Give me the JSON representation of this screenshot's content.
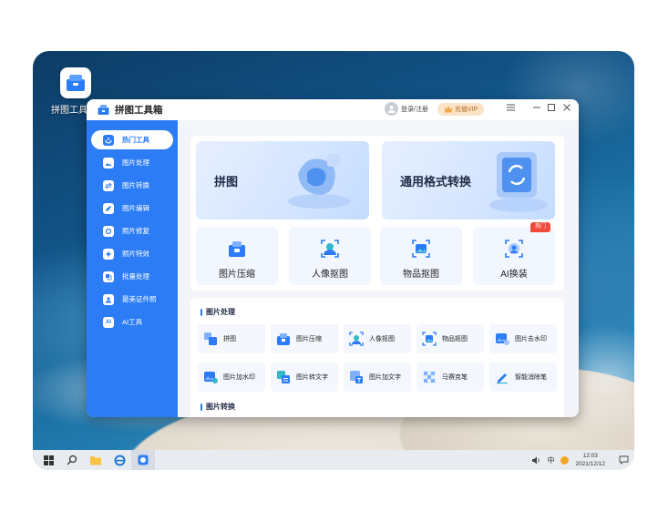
{
  "desktop": {
    "shortcut_label": "拼图工具箱"
  },
  "window": {
    "title": "拼图工具箱",
    "login_label": "登录/注册",
    "vip_label": "充值VIP",
    "controls": [
      "menu",
      "minimize",
      "maximize",
      "close"
    ]
  },
  "sidebar": {
    "items": [
      {
        "label": "热门工具",
        "icon": "hot-tools-icon",
        "active": true
      },
      {
        "label": "图片处理",
        "icon": "image-process-icon"
      },
      {
        "label": "图片转换",
        "icon": "image-convert-icon"
      },
      {
        "label": "图片编辑",
        "icon": "image-edit-icon"
      },
      {
        "label": "照片修复",
        "icon": "photo-repair-icon"
      },
      {
        "label": "照片特效",
        "icon": "photo-effect-icon"
      },
      {
        "label": "批量处理",
        "icon": "batch-icon"
      },
      {
        "label": "最美证件照",
        "icon": "id-photo-icon"
      },
      {
        "label": "AI工具",
        "icon": "ai-tools-icon"
      }
    ]
  },
  "hot": {
    "banners": [
      {
        "label": "拼图"
      },
      {
        "label": "通用格式转换"
      }
    ],
    "cards": [
      {
        "label": "图片压缩",
        "icon": "compress-icon"
      },
      {
        "label": "人像抠图",
        "icon": "portrait-cutout-icon"
      },
      {
        "label": "物品抠图",
        "icon": "object-cutout-icon"
      },
      {
        "label": "AI换装",
        "icon": "ai-outfit-icon",
        "badge": "热门"
      }
    ]
  },
  "image_processing": {
    "title": "图片处理",
    "tools": [
      {
        "label": "拼图",
        "icon": "collage-icon"
      },
      {
        "label": "图片压缩",
        "icon": "compress-icon"
      },
      {
        "label": "人像抠图",
        "icon": "portrait-cutout-icon"
      },
      {
        "label": "物品抠图",
        "icon": "object-cutout-icon"
      },
      {
        "label": "图片去水印",
        "icon": "remove-watermark-icon"
      },
      {
        "label": "图片加水印",
        "icon": "add-watermark-icon"
      },
      {
        "label": "图片转文字",
        "icon": "image-to-text-icon"
      },
      {
        "label": "图片加文字",
        "icon": "add-text-icon"
      },
      {
        "label": "马赛克笔",
        "icon": "mosaic-icon"
      },
      {
        "label": "智能消除笔",
        "icon": "smart-eraser-icon"
      }
    ]
  },
  "image_conversion": {
    "title": "图片转换"
  },
  "taskbar": {
    "ime": "中",
    "time": "12:03",
    "date": "2021/12/12"
  },
  "colors": {
    "accent": "#2c7df5",
    "hot_badge": "#f04a3a",
    "vip_bg": "#fbe3c8"
  }
}
